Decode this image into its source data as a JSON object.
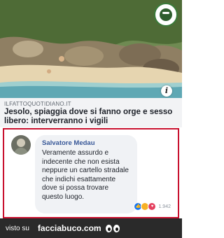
{
  "article": {
    "source": "ILFATTOQUOTIDIANO.IT",
    "headline": "Jesolo, spiaggia dove si fanno orge e sesso libero: interverranno i vigili"
  },
  "comment": {
    "author": "Salvatore Medau",
    "text": "Veramente assurdo e indecente che non esista neppure un cartello stradale che indichi esattamente dove si possa trovare questo luogo.",
    "reaction_count": "1.942",
    "reactions": [
      "like-icon",
      "haha-icon",
      "love-icon"
    ]
  },
  "footer": {
    "visto_su": "visto su",
    "brand": "facciabuco.com"
  },
  "colors": {
    "highlight_border": "#c8102e",
    "author_link": "#385898",
    "footer_bg": "#2a2a2a"
  }
}
